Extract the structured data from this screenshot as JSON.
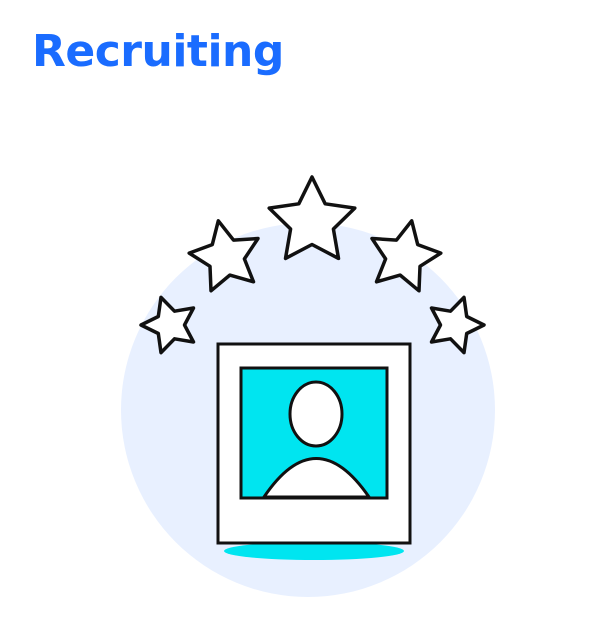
{
  "header": {
    "title": "Recruiting"
  },
  "colors": {
    "title": "#1a6cff",
    "background_circle": "#e8f0ff",
    "photo_bg": "#00e5f0",
    "shadow": "#00e5f0",
    "outline": "#111111"
  },
  "illustration": {
    "icons": [
      "star-icon",
      "profile-photo-icon"
    ],
    "star_count": 5
  }
}
